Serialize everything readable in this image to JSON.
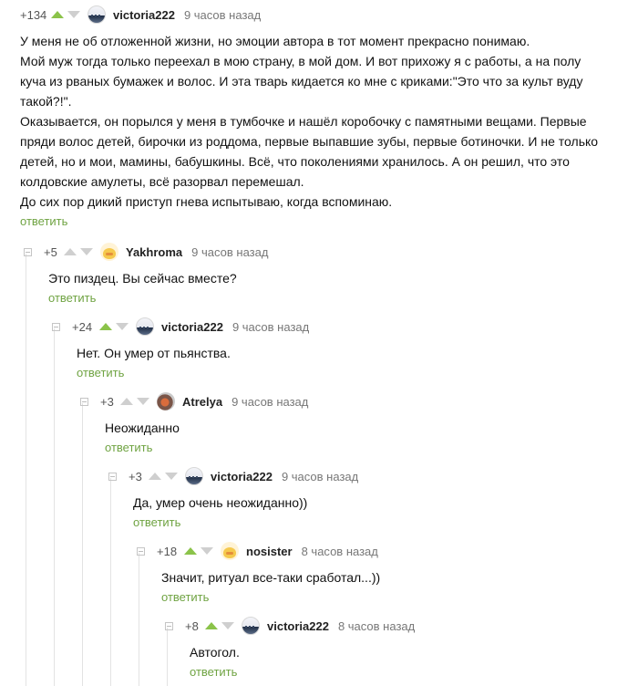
{
  "thread": [
    {
      "rating": "+134",
      "user": "victoria222",
      "time": "9 часов назад",
      "lines": [
        "У меня не об отложенной жизни, но эмоции автора в тот момент прекрасно понимаю.",
        "Мой муж тогда только переехал в мою страну, в мой дом. И вот прихожу я с работы, а на полу",
        "куча из рваных бумажек и волос. И эта тварь кидается ко мне с криками:\"Это что за культ вуду",
        "такой?!\".",
        "Оказывается, он порылся у меня в тумбочке и нашёл коробочку с памятными вещами. Первые",
        "пряди волос детей, бирочки из роддома, первые выпавшие зубы, первые ботиночки. И не только",
        "детей, но и мои, мамины, бабушкины. Всё, что поколениями хранилось. А он решил, что это",
        "колдовские амулеты, всё разорвал перемешал.",
        "До сих пор дикий приступ гнева испытываю, когда вспоминаю."
      ],
      "reply": "ответить"
    },
    {
      "rating": "+5",
      "user": "Yakhroma",
      "time": "9 часов назад",
      "lines": [
        "Это пиздец. Вы сейчас вместе?"
      ],
      "reply": "ответить"
    },
    {
      "rating": "+24",
      "user": "victoria222",
      "time": "9 часов назад",
      "lines": [
        "Нет. Он умер от пьянства."
      ],
      "reply": "ответить"
    },
    {
      "rating": "+3",
      "user": "Atrelya",
      "time": "9 часов назад",
      "lines": [
        "Неожиданно"
      ],
      "reply": "ответить"
    },
    {
      "rating": "+3",
      "user": "victoria222",
      "time": "9 часов назад",
      "lines": [
        "Да, умер очень неожиданно))"
      ],
      "reply": "ответить"
    },
    {
      "rating": "+18",
      "user": "nosister",
      "time": "8 часов назад",
      "lines": [
        "Значит, ритуал все-таки сработал...))"
      ],
      "reply": "ответить"
    },
    {
      "rating": "+8",
      "user": "victoria222",
      "time": "8 часов назад",
      "lines": [
        "Автогол."
      ],
      "reply": "ответить"
    }
  ]
}
